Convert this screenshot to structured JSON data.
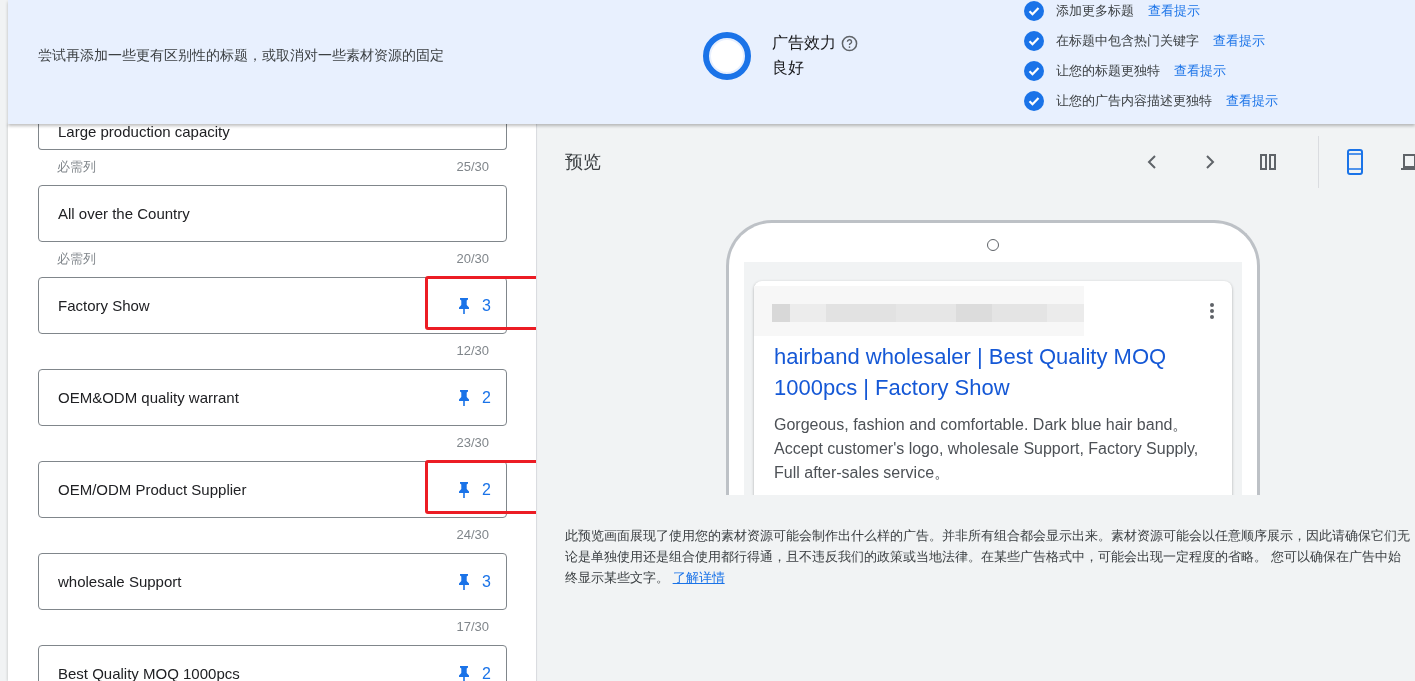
{
  "banner": {
    "message": "尝试再添加一些更有区别性的标题，或取消对一些素材资源的固定",
    "strength_label": "广告效力",
    "strength_value": "良好",
    "checklist": [
      {
        "text": "添加更多标题",
        "link": "查看提示",
        "checked": true
      },
      {
        "text": "在标题中包含热门关键字",
        "link": "查看提示",
        "checked": true
      },
      {
        "text": "让您的标题更独特",
        "link": "查看提示",
        "checked": true
      },
      {
        "text": "让您的广告内容描述更独特",
        "link": "查看提示",
        "checked": true
      }
    ]
  },
  "headlines": [
    {
      "text": "Large production capacity",
      "required_label": "必需列",
      "counter": "25/30",
      "highlighted": false
    },
    {
      "text": "All over the Country",
      "required_label": "必需列",
      "counter": "20/30",
      "highlighted": false
    },
    {
      "text": "Factory Show",
      "pin": "3",
      "counter": "12/30",
      "highlighted": true
    },
    {
      "text": "OEM&ODM quality warrant",
      "pin": "2",
      "counter": "23/30",
      "highlighted": false
    },
    {
      "text": "OEM/ODM Product Supplier",
      "pin": "2",
      "counter": "24/30",
      "highlighted": true
    },
    {
      "text": "wholesale Support",
      "pin": "3",
      "counter": "17/30",
      "highlighted": false
    },
    {
      "text": "Best Quality MOQ 1000pcs",
      "pin": "2",
      "highlighted": false
    }
  ],
  "preview": {
    "title": "预览",
    "views": [
      {
        "kind": "mobile",
        "selected": true
      },
      {
        "kind": "desktop",
        "selected": false
      }
    ],
    "ad": {
      "headline": "hairband wholesaler | Best Quality MOQ 1000pcs | Factory Show",
      "description": "Gorgeous, fashion and comfortable. Dark blue hair band。Accept customer's logo, wholesale Support, Factory Supply, Full after-sales service。"
    },
    "disclaimer": "此预览画面展现了使用您的素材资源可能会制作出什么样的广告。并非所有组合都会显示出来。素材资源可能会以任意顺序展示，因此请确保它们无论是单独使用还是组合使用都行得通，且不违反我们的政策或当地法律。在某些广告格式中，可能会出现一定程度的省略。 您可以确保在广告中始终显示某些文字。",
    "link": "了解详情"
  }
}
